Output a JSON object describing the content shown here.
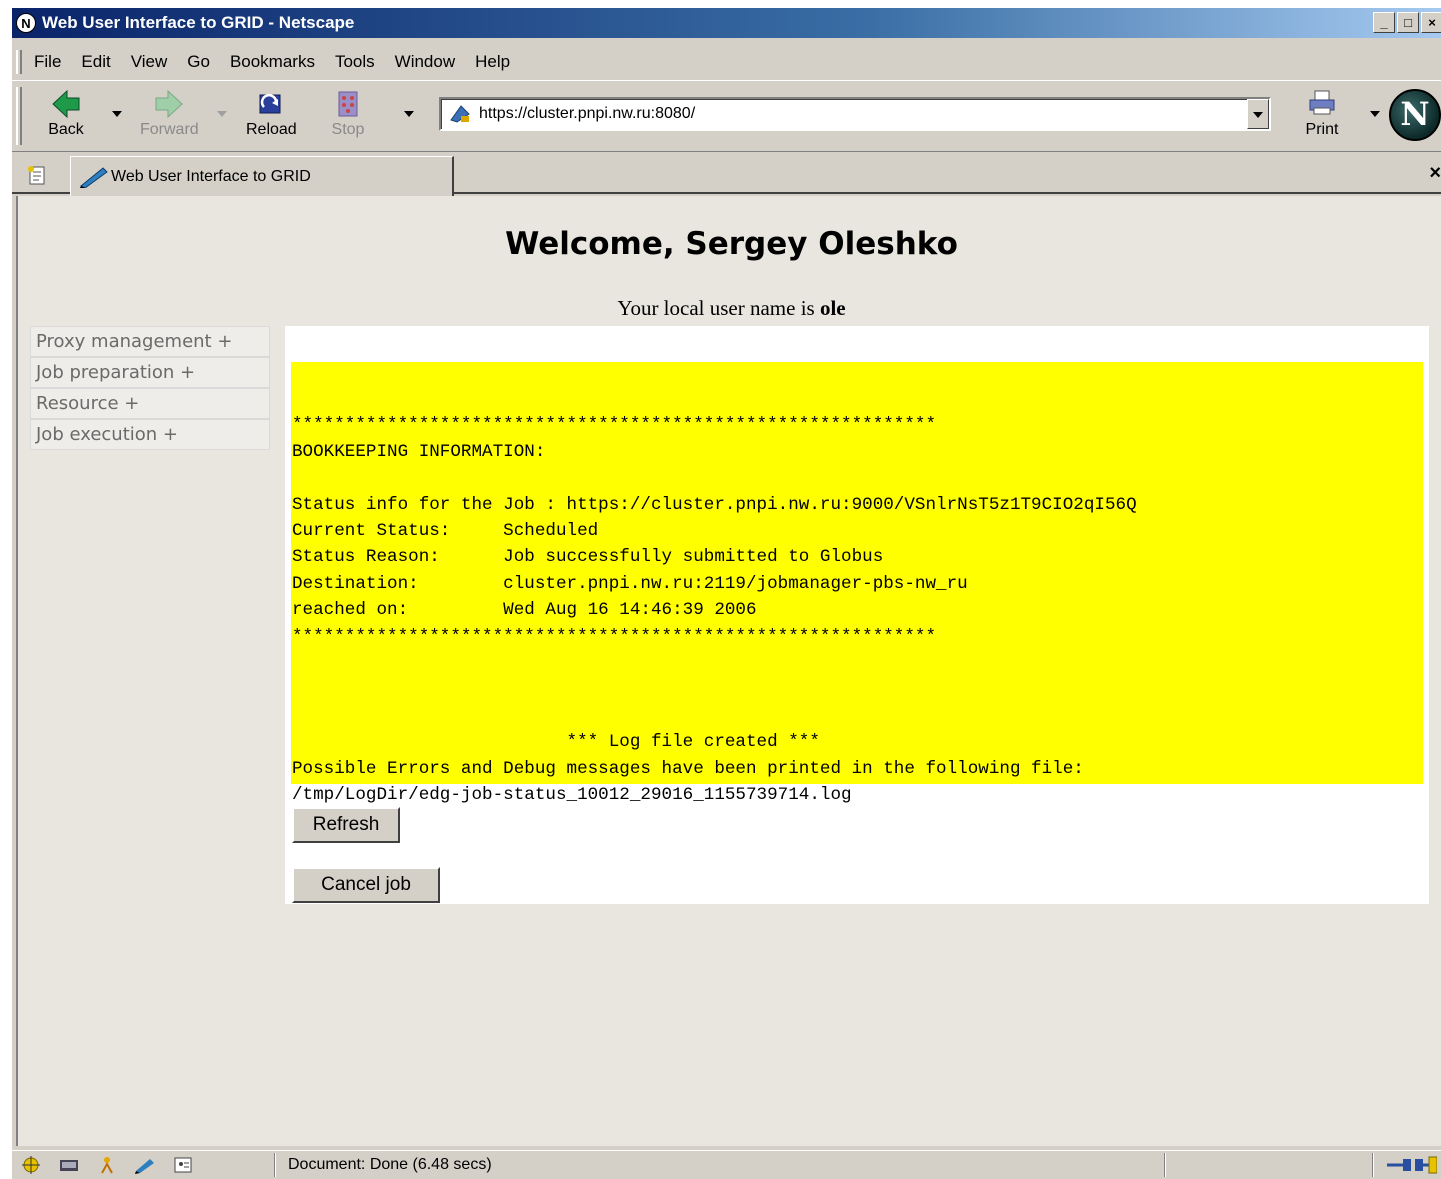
{
  "window": {
    "title": "Web User Interface to GRID - Netscape",
    "app_icon": "netscape-icon"
  },
  "menu": [
    "File",
    "Edit",
    "View",
    "Go",
    "Bookmarks",
    "Tools",
    "Window",
    "Help"
  ],
  "toolbar": {
    "back": "Back",
    "forward": "Forward",
    "reload": "Reload",
    "stop": "Stop",
    "print": "Print",
    "url": "https://cluster.pnpi.nw.ru:8080/"
  },
  "tab": {
    "label": "Web User Interface to GRID",
    "close": "×"
  },
  "page": {
    "welcome": "Welcome, Sergey Oleshko",
    "local_user_prefix": "Your local user name is",
    "local_user": "ole",
    "sidebar": [
      "Proxy management +",
      "Job preparation +",
      "Resource +",
      "Job execution +"
    ],
    "output": "\n*************************************************************\nBOOKKEEPING INFORMATION:\n\nStatus info for the Job : https://cluster.pnpi.nw.ru:9000/VSnlrNsT5z1T9CIO2qI56Q\nCurrent Status:     Scheduled\nStatus Reason:      Job successfully submitted to Globus\nDestination:        cluster.pnpi.nw.ru:2119/jobmanager-pbs-nw_ru\nreached on:         Wed Aug 16 14:46:39 2006\n*************************************************************\n\n\n\n                          *** Log file created ***\nPossible Errors and Debug messages have been printed in the following file:\n/tmp/LogDir/edg-job-status_10012_29016_1155739714.log",
    "refresh_button": "Refresh",
    "cancel_button": "Cancel job"
  },
  "status": {
    "text": "Document: Done (6.48 secs)"
  },
  "colors": {
    "output_bg": "#ffff00",
    "titlebar": "#0a246a"
  }
}
